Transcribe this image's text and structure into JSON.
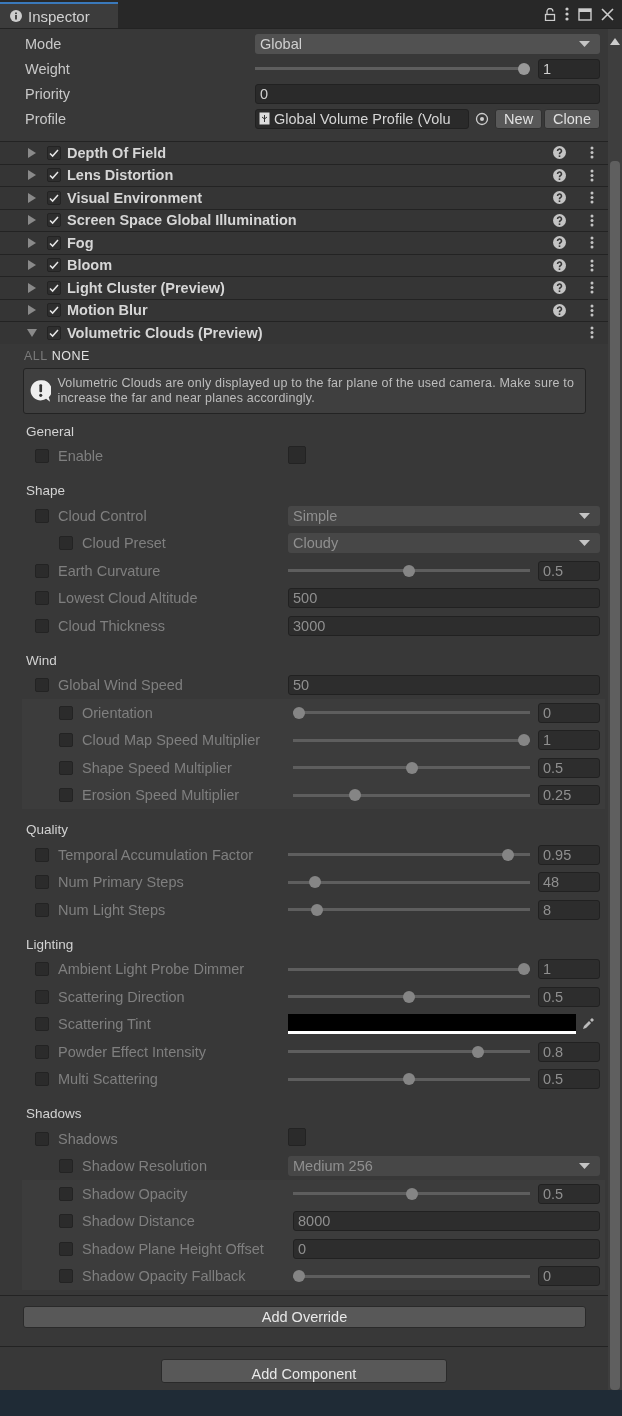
{
  "window": {
    "title": "Inspector"
  },
  "volume": [
    {
      "kind": "dropdown",
      "label": "Mode",
      "value": "Global"
    },
    {
      "kind": "slider",
      "label": "Weight",
      "level": 1,
      "value": "1"
    },
    {
      "kind": "field",
      "label": "Priority",
      "value": "0"
    },
    {
      "kind": "object",
      "label": "Profile",
      "value": "Global Volume Profile (Volu",
      "buttons": [
        "New",
        "Clone"
      ]
    }
  ],
  "components": [
    {
      "name": "Depth Of Field",
      "enabled": true,
      "expanded": false,
      "help": true
    },
    {
      "name": "Lens Distortion",
      "enabled": true,
      "expanded": false,
      "help": true
    },
    {
      "name": "Visual Environment",
      "enabled": true,
      "expanded": false,
      "help": true
    },
    {
      "name": "Screen Space Global Illumination",
      "enabled": true,
      "expanded": false,
      "help": true
    },
    {
      "name": "Fog",
      "enabled": true,
      "expanded": false,
      "help": true
    },
    {
      "name": "Bloom",
      "enabled": true,
      "expanded": false,
      "help": true
    },
    {
      "name": "Light Cluster (Preview)",
      "enabled": true,
      "expanded": false,
      "help": true
    },
    {
      "name": "Motion Blur",
      "enabled": true,
      "expanded": false,
      "help": true
    },
    {
      "name": "Volumetric Clouds (Preview)",
      "enabled": true,
      "expanded": true,
      "help": false
    }
  ],
  "filters": [
    {
      "label": "ALL",
      "disabled": true
    },
    {
      "label": "NONE",
      "disabled": false
    }
  ],
  "warning": "Volumetric Clouds are only displayed up to the far plane of the used camera. Make sure to increase the far and near planes accordingly.",
  "sections": [
    {
      "title": "General",
      "rows": [
        {
          "kind": "toggle",
          "label": "Enable",
          "override": false,
          "checked": false
        }
      ]
    },
    {
      "title": "Shape",
      "rows": [
        {
          "kind": "dropdown",
          "label": "Cloud Control",
          "override": false,
          "value": "Simple",
          "children": [
            {
              "kind": "dropdown",
              "label": "Cloud Preset",
              "override": false,
              "value": "Cloudy"
            }
          ]
        },
        {
          "kind": "slider",
          "label": "Earth Curvature",
          "override": false,
          "level": 0.5,
          "value": "0.5"
        },
        {
          "kind": "field",
          "label": "Lowest Cloud Altitude",
          "override": false,
          "value": "500"
        },
        {
          "kind": "field",
          "label": "Cloud Thickness",
          "override": false,
          "value": "3000"
        }
      ]
    },
    {
      "title": "Wind",
      "rows": [
        {
          "kind": "field",
          "label": "Global Wind Speed",
          "override": false,
          "value": "50",
          "group": [
            {
              "kind": "slider",
              "label": "Orientation",
              "override": false,
              "level": 0,
              "value": "0"
            },
            {
              "kind": "slider",
              "label": "Cloud Map Speed Multiplier",
              "override": false,
              "level": 1,
              "value": "1"
            },
            {
              "kind": "slider",
              "label": "Shape Speed Multiplier",
              "override": false,
              "level": 0.5,
              "value": "0.5"
            },
            {
              "kind": "slider",
              "label": "Erosion Speed Multiplier",
              "override": false,
              "level": 0.25,
              "value": "0.25"
            }
          ]
        }
      ]
    },
    {
      "title": "Quality",
      "rows": [
        {
          "kind": "slider",
          "label": "Temporal Accumulation Factor",
          "override": false,
          "level": 0.93,
          "value": "0.95"
        },
        {
          "kind": "slider",
          "label": "Num Primary Steps",
          "override": false,
          "level": 0.09,
          "value": "48"
        },
        {
          "kind": "slider",
          "label": "Num Light Steps",
          "override": false,
          "level": 0.1,
          "value": "8"
        }
      ]
    },
    {
      "title": "Lighting",
      "rows": [
        {
          "kind": "slider",
          "label": "Ambient Light Probe Dimmer",
          "override": false,
          "level": 1,
          "value": "1"
        },
        {
          "kind": "slider",
          "label": "Scattering Direction",
          "override": false,
          "level": 0.5,
          "value": "0.5"
        },
        {
          "kind": "color",
          "label": "Scattering Tint",
          "override": false,
          "color": "#000000"
        },
        {
          "kind": "slider",
          "label": "Powder Effect Intensity",
          "override": false,
          "level": 0.8,
          "value": "0.8"
        },
        {
          "kind": "slider",
          "label": "Multi Scattering",
          "override": false,
          "level": 0.5,
          "value": "0.5"
        }
      ]
    },
    {
      "title": "Shadows",
      "rows": [
        {
          "kind": "toggle",
          "label": "Shadows",
          "override": false,
          "checked": false,
          "children": [
            {
              "kind": "dropdown",
              "label": "Shadow Resolution",
              "override": false,
              "value": "Medium 256"
            }
          ],
          "group": [
            {
              "kind": "slider",
              "label": "Shadow Opacity",
              "override": false,
              "level": 0.5,
              "value": "0.5"
            },
            {
              "kind": "field",
              "label": "Shadow Distance",
              "override": false,
              "value": "8000"
            },
            {
              "kind": "field",
              "label": "Shadow Plane Height Offset",
              "override": false,
              "value": "0"
            },
            {
              "kind": "slider",
              "label": "Shadow Opacity Fallback",
              "override": false,
              "level": 0,
              "value": "0"
            }
          ]
        }
      ]
    }
  ],
  "buttons": {
    "add_override": "Add Override",
    "add_component": "Add Component"
  }
}
